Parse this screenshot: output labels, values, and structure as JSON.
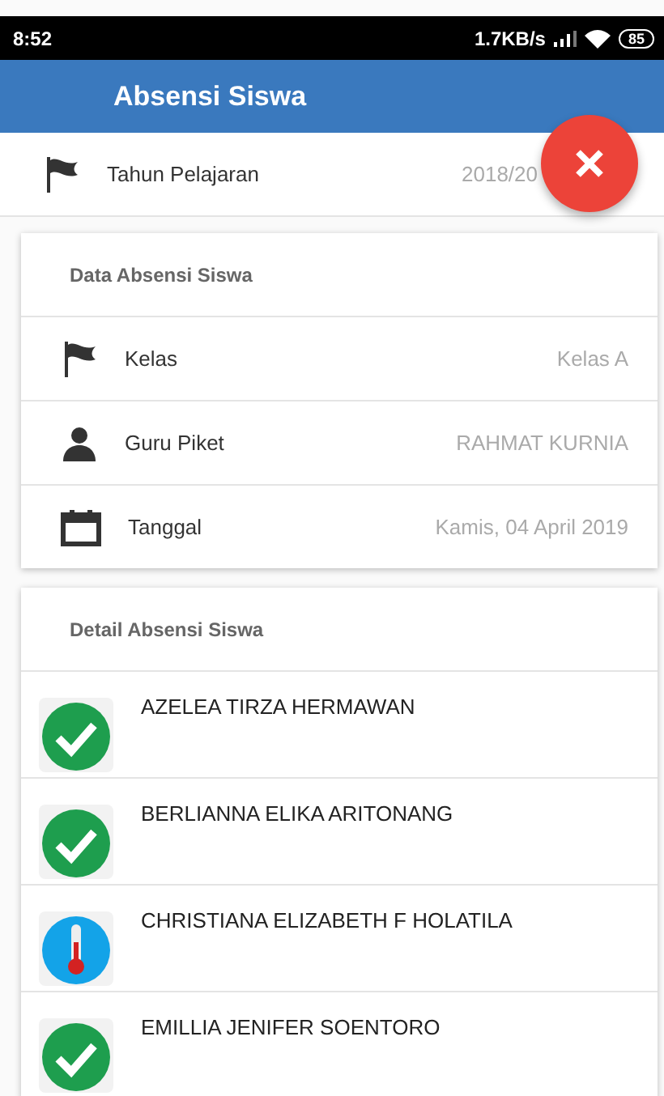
{
  "status_bar": {
    "time": "8:52",
    "speed": "1.7KB/s",
    "battery": "85"
  },
  "app_bar": {
    "title": "Absensi Siswa"
  },
  "year_row": {
    "label": "Tahun Pelajaran",
    "value": "2018/20"
  },
  "data_card": {
    "title": "Data Absensi Siswa",
    "rows": [
      {
        "kind": "flag",
        "label": "Kelas",
        "value": "Kelas A"
      },
      {
        "kind": "person",
        "label": "Guru Piket",
        "value": "RAHMAT KURNIA"
      },
      {
        "kind": "calendar",
        "label": "Tanggal",
        "value": "Kamis, 04 April 2019"
      }
    ]
  },
  "detail_card": {
    "title": "Detail Absensi Siswa",
    "students": [
      {
        "name": "AZELEA TIRZA HERMAWAN",
        "kind": "present"
      },
      {
        "name": "BERLIANNA ELIKA ARITONANG",
        "kind": "present"
      },
      {
        "name": "CHRISTIANA ELIZABETH F HOLATILA",
        "kind": "sick"
      },
      {
        "name": "EMILLIA JENIFER SOENTORO",
        "kind": "present"
      }
    ]
  }
}
